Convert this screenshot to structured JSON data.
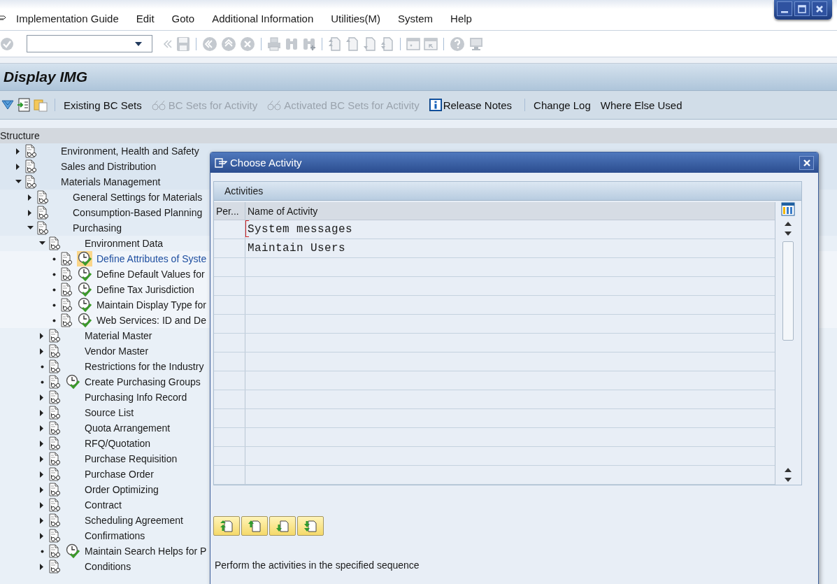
{
  "menu": [
    "Implementation Guide",
    "Edit",
    "Goto",
    "Additional Information",
    "Utilities(M)",
    "System",
    "Help"
  ],
  "title": "Display IMG",
  "app_toolbar": {
    "groups": [
      {
        "buttons": [
          {
            "label": "Existing BC Sets",
            "kind": "plain",
            "disabled": false
          },
          {
            "label": "BC Sets for Activity",
            "kind": "bc_set",
            "disabled": true
          },
          {
            "label": "Activated BC Sets for Activity",
            "kind": "bc_set",
            "disabled": true
          },
          {
            "label": "Release Notes",
            "kind": "info",
            "disabled": false
          }
        ]
      },
      {
        "buttons": [
          {
            "label": "Change Log",
            "kind": "plain",
            "disabled": false
          },
          {
            "label": "Where Else Used",
            "kind": "plain",
            "disabled": false
          }
        ]
      }
    ]
  },
  "structure": {
    "header": "Structure",
    "tree": [
      {
        "label": "Environment, Health and Safety",
        "kind": "node",
        "expanded": false,
        "has_activity": false,
        "selected": false
      },
      {
        "label": "Sales and Distribution",
        "kind": "node",
        "expanded": false,
        "has_activity": false,
        "selected": false
      },
      {
        "label": "Materials Management",
        "kind": "node",
        "expanded": true,
        "has_activity": false,
        "selected": false,
        "children": [
          {
            "label": "General Settings for Materials",
            "kind": "node",
            "expanded": false,
            "has_activity": false,
            "selected": false
          },
          {
            "label": "Consumption-Based Planning",
            "kind": "node",
            "expanded": false,
            "has_activity": false,
            "selected": false
          },
          {
            "label": "Purchasing",
            "kind": "node",
            "expanded": true,
            "has_activity": false,
            "selected": false,
            "children": [
              {
                "label": "Environment Data",
                "kind": "node",
                "expanded": true,
                "has_activity": false,
                "selected": false,
                "children": [
                  {
                    "label": "Define Attributes of Syste",
                    "kind": "leaf",
                    "has_activity": true,
                    "selected": true
                  },
                  {
                    "label": "Define Default Values for",
                    "kind": "leaf",
                    "has_activity": true,
                    "selected": false
                  },
                  {
                    "label": "Define Tax Jurisdiction",
                    "kind": "leaf",
                    "has_activity": true,
                    "selected": false
                  },
                  {
                    "label": "Maintain Display Type for",
                    "kind": "leaf",
                    "has_activity": true,
                    "selected": false
                  },
                  {
                    "label": "Web Services: ID and De",
                    "kind": "leaf",
                    "has_activity": true,
                    "selected": false
                  }
                ]
              },
              {
                "label": "Material Master",
                "kind": "node",
                "expanded": false,
                "has_activity": false,
                "selected": false
              },
              {
                "label": "Vendor Master",
                "kind": "node",
                "expanded": false,
                "has_activity": false,
                "selected": false
              },
              {
                "label": "Restrictions for the Industry",
                "kind": "leaf",
                "has_activity": false,
                "selected": false
              },
              {
                "label": "Create Purchasing Groups",
                "kind": "leaf",
                "has_activity": true,
                "selected": false
              },
              {
                "label": "Purchasing Info Record",
                "kind": "node",
                "expanded": false,
                "has_activity": false,
                "selected": false
              },
              {
                "label": "Source List",
                "kind": "node",
                "expanded": false,
                "has_activity": false,
                "selected": false
              },
              {
                "label": "Quota Arrangement",
                "kind": "node",
                "expanded": false,
                "has_activity": false,
                "selected": false
              },
              {
                "label": "RFQ/Quotation",
                "kind": "node",
                "expanded": false,
                "has_activity": false,
                "selected": false
              },
              {
                "label": "Purchase Requisition",
                "kind": "node",
                "expanded": false,
                "has_activity": false,
                "selected": false
              },
              {
                "label": "Purchase Order",
                "kind": "node",
                "expanded": false,
                "has_activity": false,
                "selected": false
              },
              {
                "label": "Order Optimizing",
                "kind": "node",
                "expanded": false,
                "has_activity": false,
                "selected": false
              },
              {
                "label": "Contract",
                "kind": "node",
                "expanded": false,
                "has_activity": false,
                "selected": false
              },
              {
                "label": "Scheduling Agreement",
                "kind": "node",
                "expanded": false,
                "has_activity": false,
                "selected": false
              },
              {
                "label": "Confirmations",
                "kind": "node",
                "expanded": false,
                "has_activity": false,
                "selected": false
              },
              {
                "label": "Maintain Search Helps for P",
                "kind": "leaf",
                "has_activity": true,
                "selected": false
              },
              {
                "label": "Conditions",
                "kind": "node",
                "expanded": false,
                "has_activity": false,
                "selected": false
              }
            ]
          }
        ]
      }
    ]
  },
  "dialog": {
    "title": "Choose Activity",
    "section": "Activities",
    "columns": [
      "Per...",
      "Name of Activity"
    ],
    "rows": [
      {
        "name": "System messages",
        "focused": true
      },
      {
        "name": "Maintain Users",
        "focused": false
      }
    ],
    "hint": "Perform the activities in the specified sequence"
  }
}
